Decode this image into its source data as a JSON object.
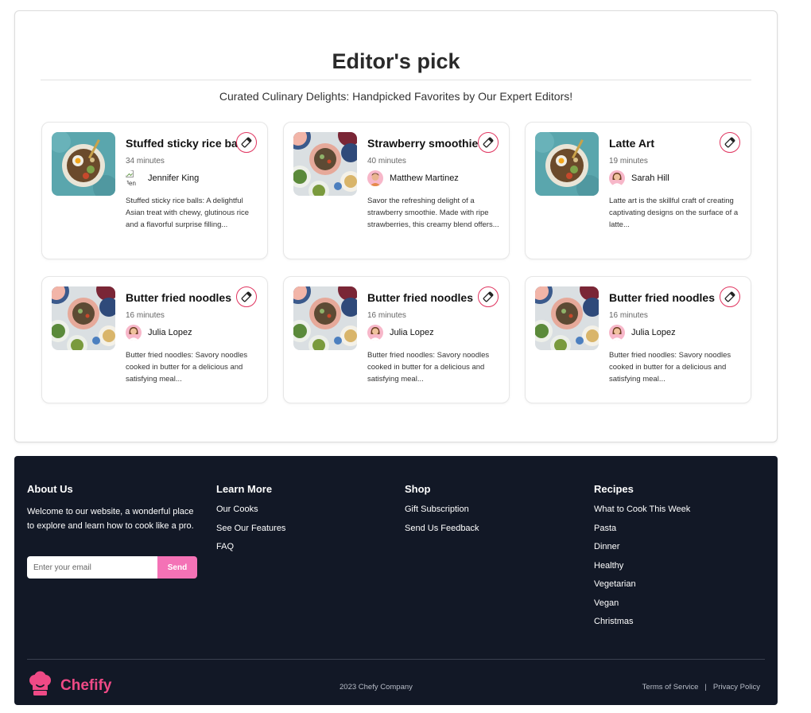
{
  "editors_pick": {
    "title": "Editor's pick",
    "subtitle": "Curated Culinary Delights: Handpicked Favorites by Our Expert Editors!",
    "cards": [
      {
        "title": "Stuffed sticky rice ball",
        "time": "34 minutes",
        "author": "Jennifer King",
        "avatar_alt": "Jen",
        "description": "Stuffed sticky rice balls: A delightful Asian treat with chewy, glutinous rice and a flavorful surprise filling...",
        "image": "bowl-dish-photo",
        "avatar": "broken-image"
      },
      {
        "title": "Strawberry smoothie",
        "time": "40 minutes",
        "author": "Matthew Martinez",
        "description": "Savor the refreshing delight of a strawberry smoothie. Made with ripe strawberries, this creamy blend offers...",
        "image": "table-spread-photo",
        "avatar": "man-avatar"
      },
      {
        "title": "Latte Art",
        "time": "19 minutes",
        "author": "Sarah Hill",
        "description": "Latte art is the skillful craft of creating captivating designs on the surface of a latte...",
        "image": "bowl-dish-photo",
        "avatar": "woman-avatar"
      },
      {
        "title": "Butter fried noodles",
        "time": "16 minutes",
        "author": "Julia Lopez",
        "description": "Butter fried noodles: Savory noodles cooked in butter for a delicious and satisfying meal...",
        "image": "table-spread-photo",
        "avatar": "woman-avatar"
      },
      {
        "title": "Butter fried noodles",
        "time": "16 minutes",
        "author": "Julia Lopez",
        "description": "Butter fried noodles: Savory noodles cooked in butter for a delicious and satisfying meal...",
        "image": "table-spread-photo",
        "avatar": "woman-avatar"
      },
      {
        "title": "Butter fried noodles",
        "time": "16 minutes",
        "author": "Julia Lopez",
        "description": "Butter fried noodles: Savory noodles cooked in butter for a delicious and satisfying meal...",
        "image": "table-spread-photo",
        "avatar": "woman-avatar"
      }
    ],
    "save_icon": "bookmark-icon"
  },
  "footer": {
    "about": {
      "heading": "About Us",
      "text": "Welcome to our website, a wonderful place to explore and learn how to cook like a pro.",
      "email_placeholder": "Enter your email",
      "send_label": "Send"
    },
    "learn_more": {
      "heading": "Learn More",
      "links": [
        "Our Cooks",
        "See Our Features",
        "FAQ"
      ]
    },
    "shop": {
      "heading": "Shop",
      "links": [
        "Gift Subscription",
        "Send Us Feedback"
      ]
    },
    "recipes": {
      "heading": "Recipes",
      "links": [
        "What to Cook This Week",
        "Pasta",
        "Dinner",
        "Healthy",
        "Vegetarian",
        "Vegan",
        "Christmas"
      ]
    },
    "brand": "Chefify",
    "logo_icon": "chef-hat-icon",
    "copyright": "2023 Chefy Company",
    "legal": {
      "terms": "Terms of Service",
      "separator": "|",
      "privacy": "Privacy Policy"
    }
  },
  "colors": {
    "accent_pink": "#f472b6",
    "brand_pink": "#ef4a86",
    "save_red": "#e0345f",
    "footer_bg": "#121826"
  }
}
